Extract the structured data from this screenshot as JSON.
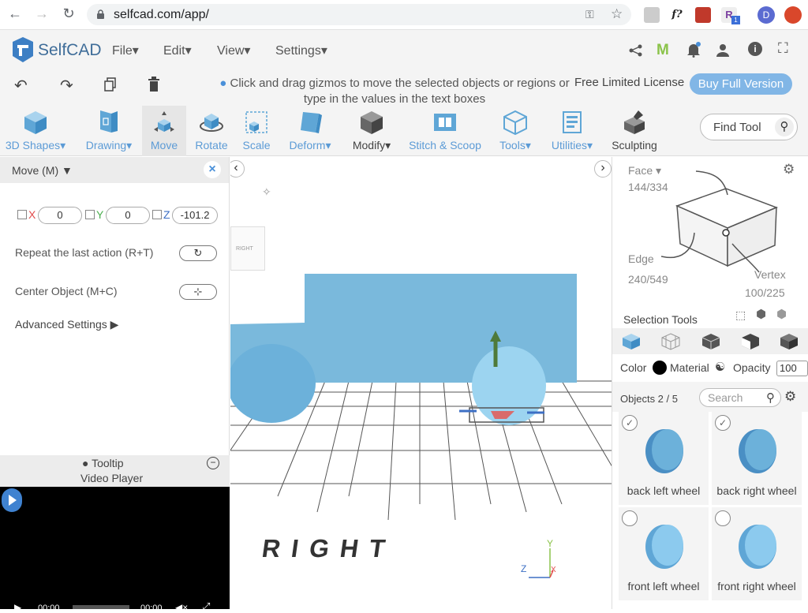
{
  "browser": {
    "url": "selfcad.com/app/",
    "profile_initial": "D",
    "ext_labels": [
      "f?",
      "R",
      "1"
    ]
  },
  "app": {
    "logo_text": "SelfCAD",
    "menus": [
      "File",
      "Edit",
      "View",
      "Settings"
    ],
    "header_icons": [
      "share-icon",
      "m-icon",
      "notifications-icon",
      "user-icon",
      "info-icon",
      "fullscreen-icon"
    ]
  },
  "actionbar": {
    "hint": "Click and drag gizmos to move the selected objects or regions or type in the values in the text boxes",
    "license": "Free Limited License",
    "buy_button": "Buy Full Version"
  },
  "toolbar": {
    "tools": [
      {
        "label": "3D Shapes",
        "dropdown": true,
        "icon": "cube-icon"
      },
      {
        "label": "Drawing",
        "dropdown": true,
        "icon": "drawing-icon"
      },
      {
        "label": "Move",
        "dropdown": false,
        "icon": "move-icon",
        "active": true
      },
      {
        "label": "Rotate",
        "dropdown": false,
        "icon": "rotate-icon"
      },
      {
        "label": "Scale",
        "dropdown": false,
        "icon": "scale-icon"
      },
      {
        "label": "Deform",
        "dropdown": true,
        "icon": "deform-icon"
      },
      {
        "label": "Modify",
        "dropdown": true,
        "icon": "modify-icon"
      },
      {
        "label": "Stitch & Scoop",
        "dropdown": false,
        "icon": "stitch-icon"
      },
      {
        "label": "Tools",
        "dropdown": true,
        "icon": "tools-icon"
      },
      {
        "label": "Utilities",
        "dropdown": true,
        "icon": "utilities-icon"
      },
      {
        "label": "Sculpting",
        "dropdown": false,
        "icon": "sculpting-icon"
      }
    ],
    "find_tool": "Find Tool"
  },
  "leftpanel": {
    "title": "Move (M)",
    "coords": {
      "x_label": "X",
      "x_value": "0",
      "y_label": "Y",
      "y_value": "0",
      "z_label": "Z",
      "z_value": "-101.2"
    },
    "repeat_label": "Repeat the last action (R+T)",
    "center_label": "Center Object (M+C)",
    "advanced_label": "Advanced Settings",
    "tooltip_label": "Tooltip",
    "video_label": "Video Player",
    "video_time_start": "00:00",
    "video_time_end": "00:00"
  },
  "viewport": {
    "view_label": "RIGHT",
    "cube_face_label": "RIGHT",
    "axis_y": "Y",
    "axis_z": "Z",
    "axis_x": "X"
  },
  "rightpanel": {
    "face_label": "Face",
    "face_count": "144/334",
    "edge_label": "Edge",
    "edge_count": "240/549",
    "vertex_label": "Vertex",
    "vertex_count": "100/225",
    "selection_tools": "Selection Tools",
    "color_label": "Color",
    "material_label": "Material",
    "opacity_label": "Opacity",
    "opacity_value": "100",
    "objects_label": "Objects 2 / 5",
    "search_placeholder": "Search",
    "objects": [
      {
        "name": "back left wheel",
        "checked": true
      },
      {
        "name": "back right wheel",
        "checked": true
      },
      {
        "name": "front left wheel",
        "checked": false
      },
      {
        "name": "front right wheel",
        "checked": false
      }
    ]
  },
  "colors": {
    "accent": "#5c9bd6",
    "model": "#7ab9dc",
    "button": "#81b6e6"
  }
}
